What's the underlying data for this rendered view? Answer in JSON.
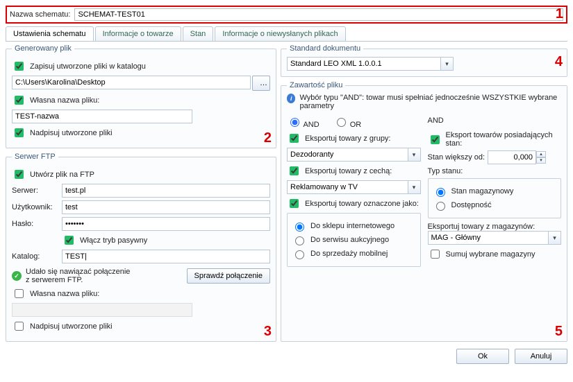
{
  "top": {
    "label": "Nazwa schematu:",
    "value": "SCHEMAT-TEST01",
    "call": "1"
  },
  "tabs": [
    "Ustawienia schematu",
    "Informacje o towarze",
    "Stan",
    "Informacje o niewysłanych plikach"
  ],
  "gen": {
    "legend": "Generowany plik",
    "saveInDir": "Zapisuj utworzone pliki w katalogu",
    "path": "C:\\Users\\Karolina\\Desktop",
    "ownName": "Własna nazwa pliku:",
    "name": "TEST-nazwa",
    "overwrite": "Nadpisuj utworzone pliki",
    "call": "2"
  },
  "ftp": {
    "legend": "Serwer FTP",
    "create": "Utwórz plik na FTP",
    "serverL": "Serwer:",
    "server": "test.pl",
    "userL": "Użytkownik:",
    "user": "test",
    "passL": "Hasło:",
    "pass": "•••••••",
    "passive": "Włącz tryb pasywny",
    "dirL": "Katalog:",
    "dir": "TEST|",
    "okMsg": "Udało się nawiązać połączenie\nz serwerem FTP.",
    "checkBtn": "Sprawdź połączenie",
    "ownName": "Własna nazwa pliku:",
    "overwrite": "Nadpisuj utworzone pliki",
    "call": "3"
  },
  "std": {
    "legend": "Standard dokumentu",
    "value": "Standard LEO XML 1.0.0.1",
    "call": "4"
  },
  "content": {
    "legend": "Zawartość pliku",
    "info": "Wybór typu \"AND\": towar musi spełniać jednocześnie WSZYSTKIE wybrane parametry",
    "and": "AND",
    "or": "OR",
    "andHead": "AND",
    "expGroup": "Eksportuj towary z grupy:",
    "group": "Dezodoranty",
    "expFeat": "Eksportuj towary z cechą:",
    "feat": "Reklamowany w TV",
    "expMarked": "Eksportuj towary oznaczone jako:",
    "r1": "Do sklepu internetowego",
    "r2": "Do serwisu aukcyjnego",
    "r3": "Do sprzedaży mobilnej",
    "expStock": "Eksport towarów posiadających stan:",
    "stockGt": "Stan większy od:",
    "stockVal": "0,000",
    "stockType": "Typ stanu:",
    "st1": "Stan magazynowy",
    "st2": "Dostępność",
    "expMag": "Eksportuj towary z magazynów:",
    "mag": "MAG - Główny",
    "sum": "Sumuj wybrane magazyny",
    "call": "5"
  },
  "foot": {
    "ok": "Ok",
    "cancel": "Anuluj"
  }
}
